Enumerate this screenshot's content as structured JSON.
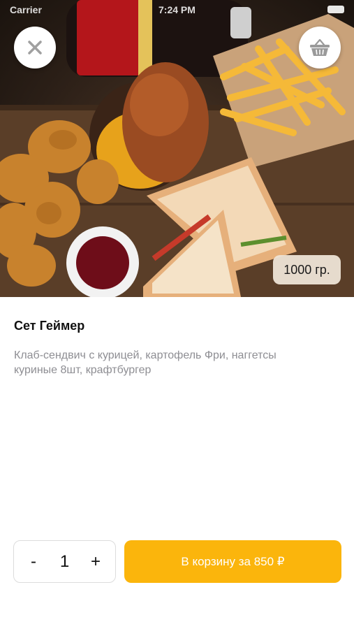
{
  "status_bar": {
    "carrier": "Carrier",
    "time": "7:24 PM"
  },
  "header": {
    "close_icon": "close-icon",
    "basket_icon": "basket-icon"
  },
  "product": {
    "image_badge": "1000 гр.",
    "name": "Сет Геймер",
    "description": "Клаб-сендвич с курицей, картофель Фри, наггетсы куриные 8шт, крафтбургер"
  },
  "quantity": {
    "minus_label": "-",
    "value": "1",
    "plus_label": "+"
  },
  "cart_button": {
    "label": "В корзину за 850 ₽"
  },
  "colors": {
    "accent": "#fbb50c",
    "text_secondary": "#8e8e93"
  }
}
